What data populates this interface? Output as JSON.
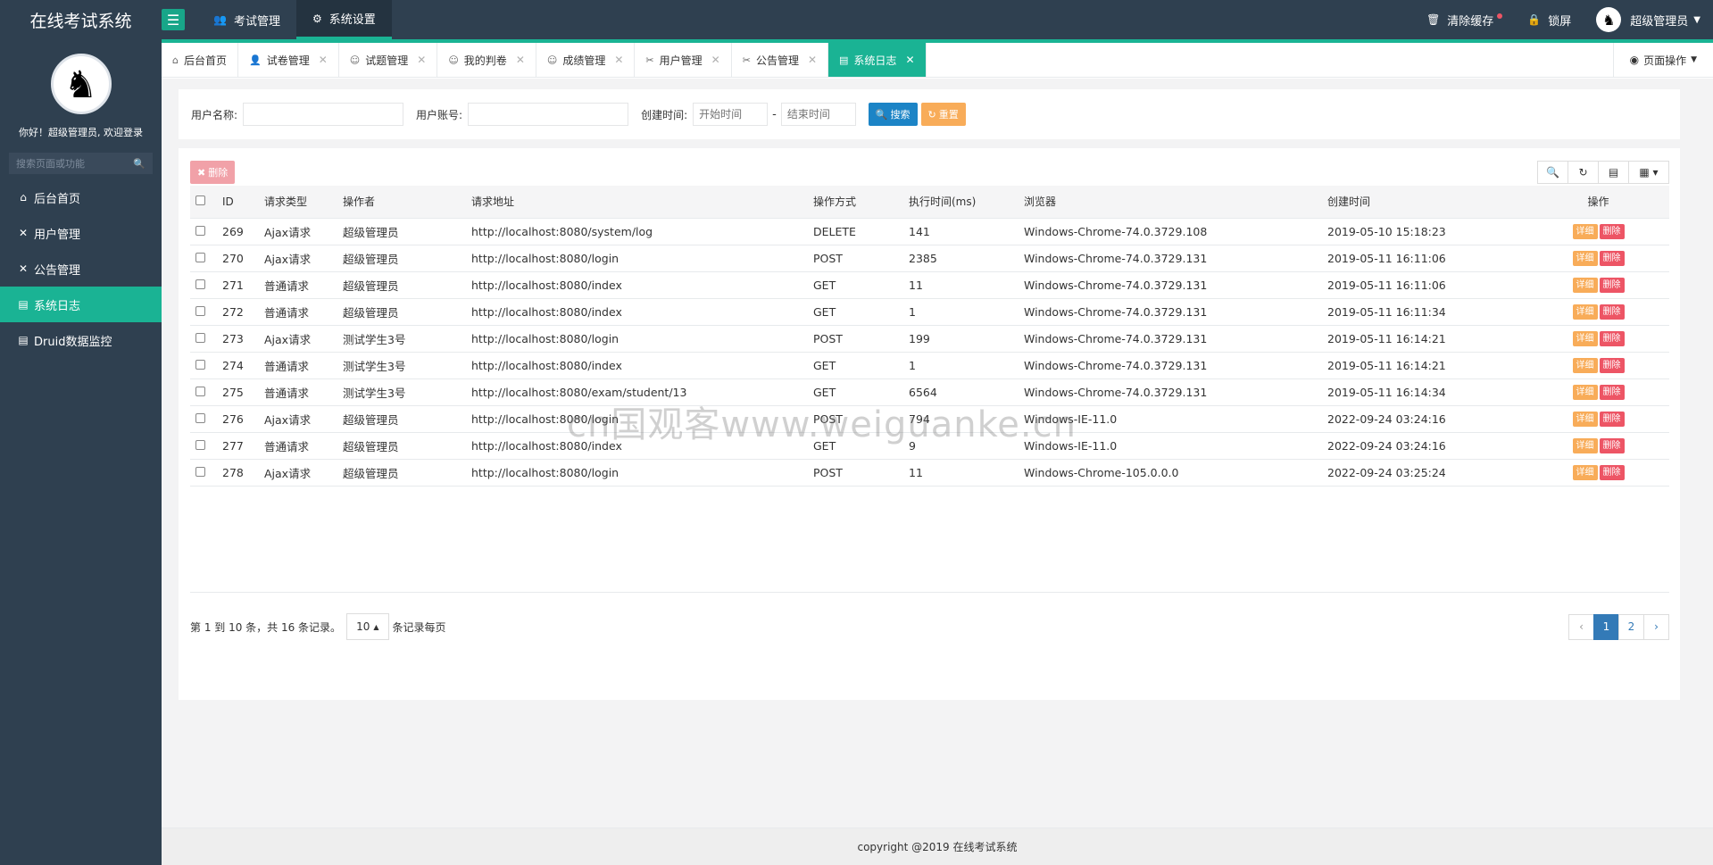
{
  "app": {
    "title": "在线考试系统"
  },
  "topnav": [
    {
      "label": "考试管理",
      "icon": "users-icon",
      "active": false
    },
    {
      "label": "系统设置",
      "icon": "gear-icon",
      "active": true
    }
  ],
  "top_right": {
    "clear_cache": "清除缓存",
    "lock": "锁屏",
    "user": "超级管理员"
  },
  "sidebar": {
    "welcome": "你好！超级管理员, 欢迎登录",
    "search_placeholder": "搜索页面或功能",
    "items": [
      {
        "label": "后台首页",
        "icon": "home-icon",
        "active": false
      },
      {
        "label": "用户管理",
        "icon": "wrench-icon",
        "active": false
      },
      {
        "label": "公告管理",
        "icon": "wrench-icon",
        "active": false
      },
      {
        "label": "系统日志",
        "icon": "file-icon",
        "active": true
      },
      {
        "label": "Druid数据监控",
        "icon": "file-icon",
        "active": false
      }
    ]
  },
  "tabs": [
    {
      "label": "后台首页",
      "closable": false,
      "active": false
    },
    {
      "label": "试卷管理",
      "closable": true,
      "active": false
    },
    {
      "label": "试题管理",
      "closable": true,
      "active": false
    },
    {
      "label": "我的判卷",
      "closable": true,
      "active": false
    },
    {
      "label": "成绩管理",
      "closable": true,
      "active": false
    },
    {
      "label": "用户管理",
      "closable": true,
      "active": false
    },
    {
      "label": "公告管理",
      "closable": true,
      "active": false
    },
    {
      "label": "系统日志",
      "closable": true,
      "active": true
    }
  ],
  "page_ops": "页面操作",
  "search": {
    "user_name_label": "用户名称:",
    "user_account_label": "用户账号:",
    "created_label": "创建时间:",
    "start_placeholder": "开始时间",
    "end_placeholder": "结束时间",
    "dash": "-",
    "search_btn": "搜索",
    "reset_btn": "重置"
  },
  "toolbar": {
    "delete_btn": "删除"
  },
  "table": {
    "headers": [
      "ID",
      "请求类型",
      "操作者",
      "请求地址",
      "操作方式",
      "执行时间(ms)",
      "浏览器",
      "创建时间",
      "操作"
    ],
    "detail_label": "详细",
    "delete_label": "删除",
    "rows": [
      [
        "269",
        "Ajax请求",
        "超级管理员",
        "http://localhost:8080/system/log",
        "DELETE",
        "141",
        "Windows-Chrome-74.0.3729.108",
        "2019-05-10 15:18:23"
      ],
      [
        "270",
        "Ajax请求",
        "超级管理员",
        "http://localhost:8080/login",
        "POST",
        "2385",
        "Windows-Chrome-74.0.3729.131",
        "2019-05-11 16:11:06"
      ],
      [
        "271",
        "普通请求",
        "超级管理员",
        "http://localhost:8080/index",
        "GET",
        "11",
        "Windows-Chrome-74.0.3729.131",
        "2019-05-11 16:11:06"
      ],
      [
        "272",
        "普通请求",
        "超级管理员",
        "http://localhost:8080/index",
        "GET",
        "1",
        "Windows-Chrome-74.0.3729.131",
        "2019-05-11 16:11:34"
      ],
      [
        "273",
        "Ajax请求",
        "测试学生3号",
        "http://localhost:8080/login",
        "POST",
        "199",
        "Windows-Chrome-74.0.3729.131",
        "2019-05-11 16:14:21"
      ],
      [
        "274",
        "普通请求",
        "测试学生3号",
        "http://localhost:8080/index",
        "GET",
        "1",
        "Windows-Chrome-74.0.3729.131",
        "2019-05-11 16:14:21"
      ],
      [
        "275",
        "普通请求",
        "测试学生3号",
        "http://localhost:8080/exam/student/13",
        "GET",
        "6564",
        "Windows-Chrome-74.0.3729.131",
        "2019-05-11 16:14:34"
      ],
      [
        "276",
        "Ajax请求",
        "超级管理员",
        "http://localhost:8080/login",
        "POST",
        "794",
        "Windows-IE-11.0",
        "2022-09-24 03:24:16"
      ],
      [
        "277",
        "普通请求",
        "超级管理员",
        "http://localhost:8080/index",
        "GET",
        "9",
        "Windows-IE-11.0",
        "2022-09-24 03:24:16"
      ],
      [
        "278",
        "Ajax请求",
        "超级管理员",
        "http://localhost:8080/login",
        "POST",
        "11",
        "Windows-Chrome-105.0.0.0",
        "2022-09-24 03:25:24"
      ]
    ]
  },
  "pager": {
    "info": "第 1 到 10 条，共 16 条记录。",
    "page_size": "10",
    "per_page_suffix": "条记录每页",
    "prev": "‹",
    "next": "›",
    "pages": [
      "1",
      "2"
    ],
    "current": "1"
  },
  "footer": "copyright @2019 在线考试系统",
  "watermark": "cn国观客www.weiguanke.cn",
  "colors": {
    "sidebar_bg": "#2f4050",
    "accent": "#1ab394",
    "primary": "#1c84c6",
    "warning": "#f8ac59",
    "danger": "#ed5565"
  }
}
